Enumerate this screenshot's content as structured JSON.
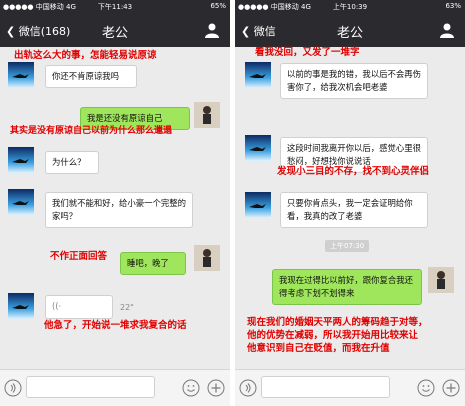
{
  "colors": {
    "bar": "#2b2b2f",
    "chat_bg": "#ebebeb",
    "my_bubble": "#a0e65c",
    "annotation": "#e10000"
  },
  "icons": {
    "person": "person-icon",
    "voice": "voice-icon",
    "emoji": "emoji-icon",
    "plus": "plus-icon"
  },
  "left": {
    "status": {
      "carrier": "●●●●● 中国移动  4G",
      "time": "下午11:43",
      "battery": "65%"
    },
    "nav": {
      "back": "微信(168)",
      "title": "老公"
    },
    "messages": [
      "你还不肯原谅我吗",
      "我是还没有原谅自己",
      "为什么？",
      "我们就不能和好，给小豪一个完整的家吗？",
      "睡吧，晚了"
    ],
    "voice": {
      "duration": "22\""
    },
    "annotations": [
      "出轨这么大的事，怎能轻易说原谅",
      "其实是没有原谅自己以前为什么那么邋遢",
      "不作正面回答",
      "他急了，开始说一堆求我复合的话"
    ]
  },
  "right": {
    "status": {
      "carrier": "●●●●● 中国移动  4G",
      "time": "上午10:39",
      "battery": "63%"
    },
    "nav": {
      "back": "微信",
      "title": "老公"
    },
    "messages": [
      "以前的事是我的错，我以后不会再伤害你了，给我次机会吧老婆",
      "这段时间我离开你以后，感觉心里很愁闷，好想找你说说话",
      "只要你肯点头，我一定会证明给你看，我真的改了老婆",
      "我现在过得比以前好，跟你复合我还得考虑下划不划得来"
    ],
    "timestamp": "上午07:30",
    "annotations": [
      "看我没回，又发了一堆字",
      "发现小三目的不存，找不到心灵伴侣",
      "现在我们的婚姻天平两人的筹码趋于对等，",
      "他的优势在减弱，所以我开始用比较来让",
      "他意识到自己在贬值，而我在升值"
    ]
  }
}
